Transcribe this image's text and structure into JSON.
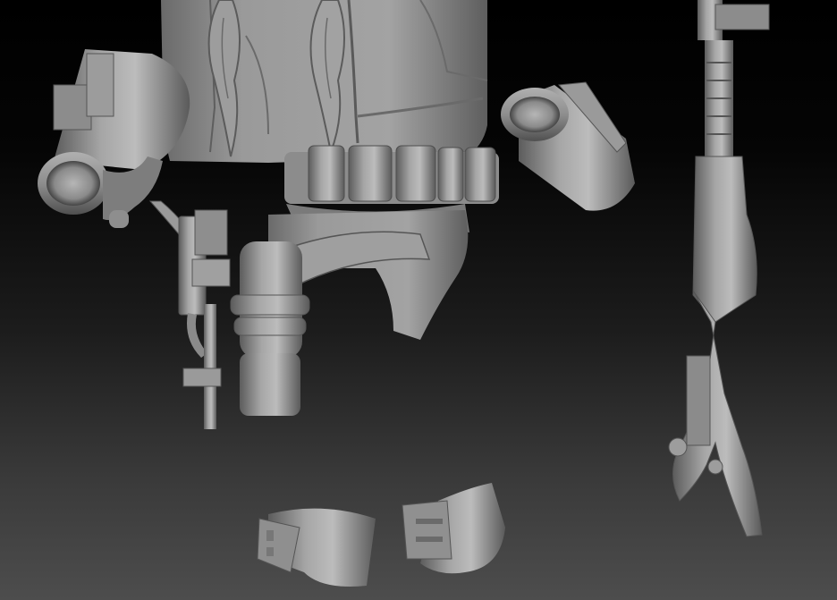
{
  "scene": {
    "description_tag": "zbrush-matcap-render",
    "background": {
      "top_color": "#000000",
      "bottom_color": "#4d4d4d"
    },
    "material": {
      "base": "#8f8f8f",
      "light": "#bdbdbd",
      "dark": "#4a4a4a",
      "shadow": "#2e2e2e"
    },
    "parts": [
      {
        "name": "torso-armor",
        "icon": "armor-torso"
      },
      {
        "name": "ammo-belt",
        "pouch_count": 5
      },
      {
        "name": "left-gauntlet"
      },
      {
        "name": "right-gauntlet"
      },
      {
        "name": "blaster-pistol"
      },
      {
        "name": "holster"
      },
      {
        "name": "rifle"
      },
      {
        "name": "ankle-cuff-left"
      },
      {
        "name": "ankle-cuff-right"
      }
    ]
  }
}
